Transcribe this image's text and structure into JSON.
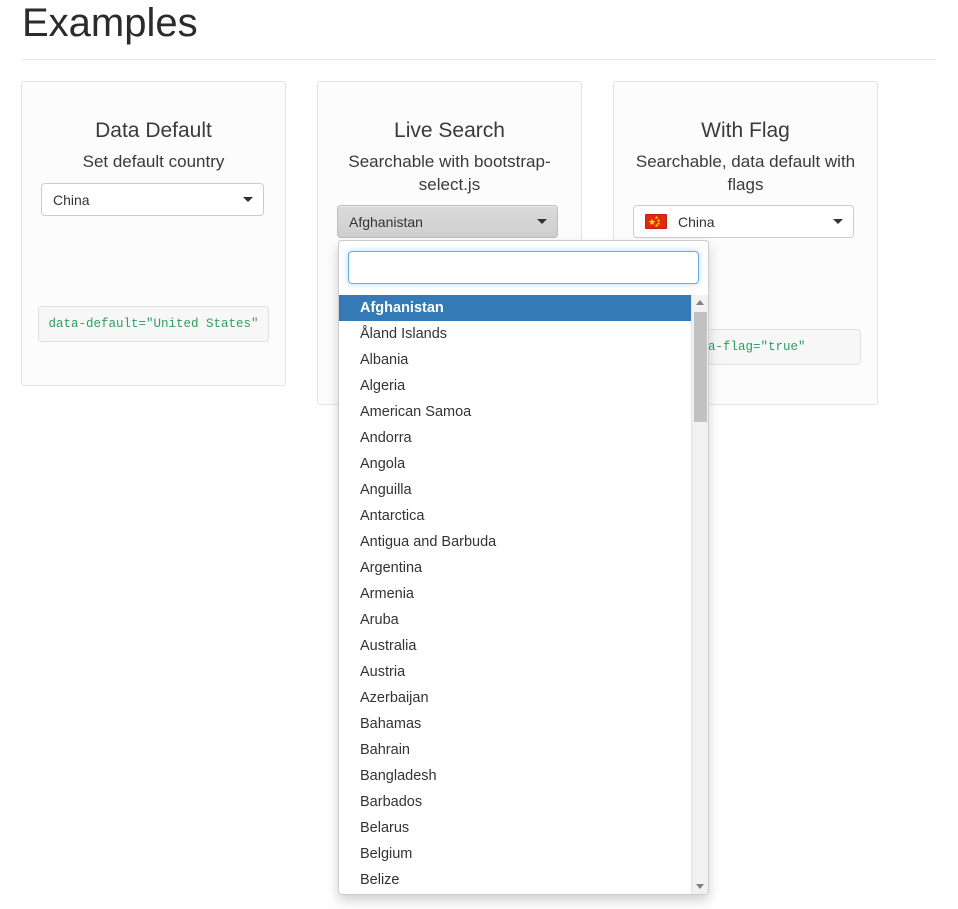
{
  "page": {
    "title": "Examples"
  },
  "cards": [
    {
      "title": "Data Default",
      "subtitle": "Set default country",
      "select": {
        "value": "China",
        "has_flag": false,
        "style": "plain"
      },
      "code": "data-default=\"United States\""
    },
    {
      "title": "Live Search",
      "subtitle": "Searchable with bootstrap-select.js",
      "select": {
        "value": "Afghanistan",
        "has_flag": false,
        "style": "bootstrap-select"
      },
      "code": ""
    },
    {
      "title": "With Flag",
      "subtitle": "Searchable, data default with flags",
      "select": {
        "value": "China",
        "has_flag": true,
        "flag_name": "china-flag",
        "flag_colors": {
          "field": "#de2910",
          "star": "#ffde00"
        },
        "style": "plain"
      },
      "code": "data-flag=\"true\""
    }
  ],
  "dropdown": {
    "owner": "Live Search",
    "search": {
      "value": "",
      "placeholder": ""
    },
    "selected": "Afghanistan",
    "items": [
      "Afghanistan",
      "Åland Islands",
      "Albania",
      "Algeria",
      "American Samoa",
      "Andorra",
      "Angola",
      "Anguilla",
      "Antarctica",
      "Antigua and Barbuda",
      "Argentina",
      "Armenia",
      "Aruba",
      "Australia",
      "Austria",
      "Azerbaijan",
      "Bahamas",
      "Bahrain",
      "Bangladesh",
      "Barbados",
      "Belarus",
      "Belgium",
      "Belize"
    ],
    "scrollbar": {
      "up_arrow": "scroll-up-arrow",
      "down_arrow": "scroll-down-arrow"
    }
  },
  "colors": {
    "highlight": "#337ab7",
    "focus_border": "#66afe9",
    "code_text": "#2e9e62",
    "card_border": "#e3e3e3"
  }
}
